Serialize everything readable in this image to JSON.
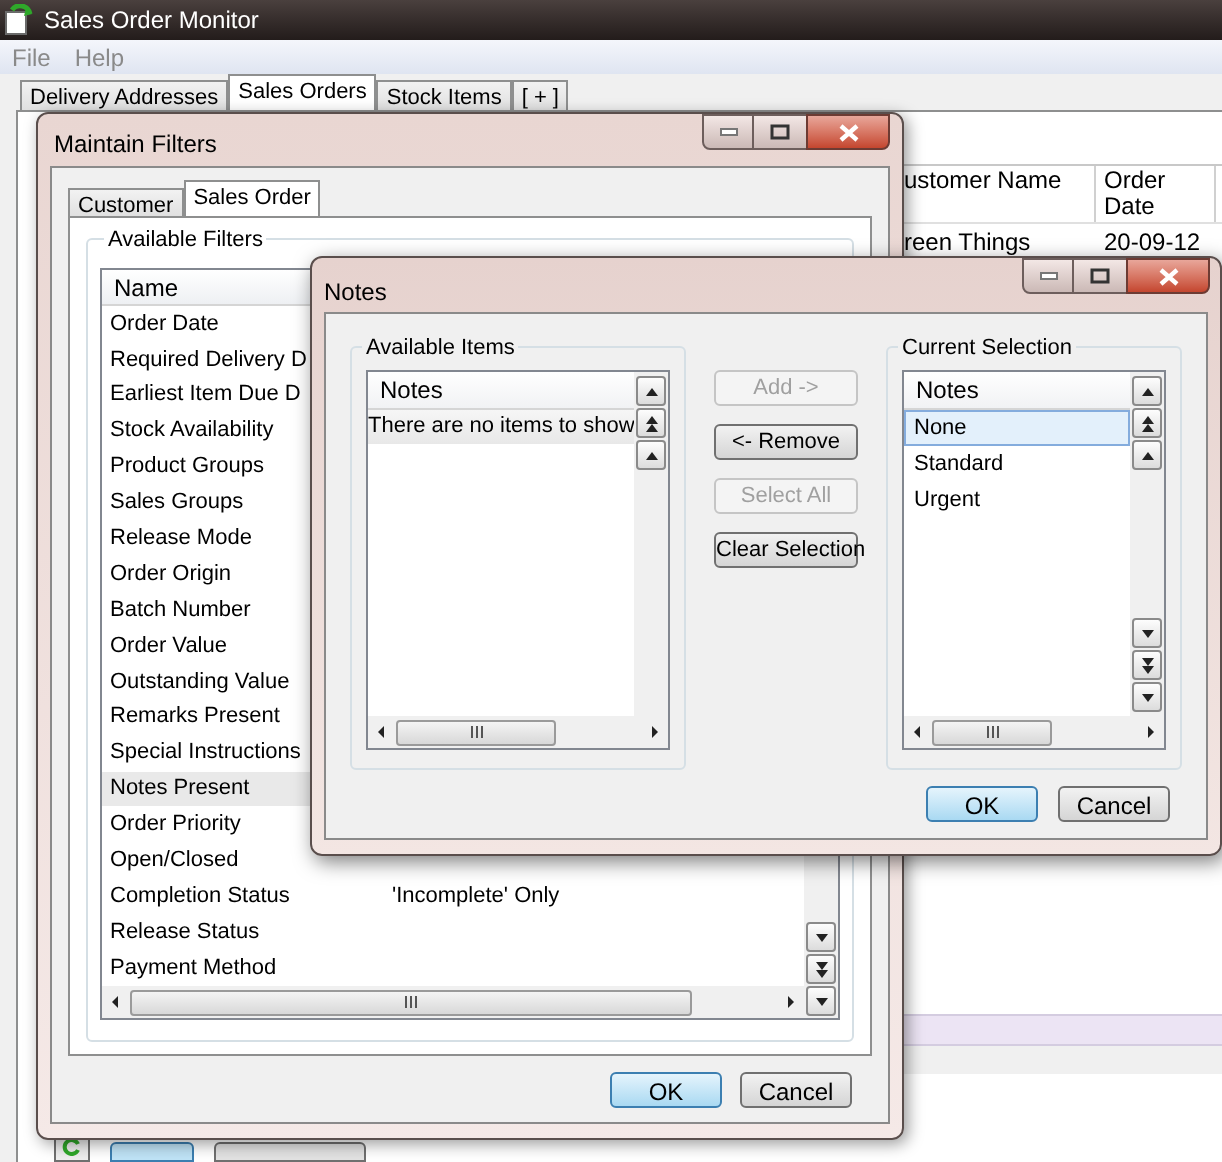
{
  "window": {
    "title": "Sales Order Monitor"
  },
  "menu": [
    "File",
    "Help"
  ],
  "tabs": [
    {
      "label": "Delivery Addresses",
      "selected": false
    },
    {
      "label": "Sales Orders",
      "selected": true
    },
    {
      "label": "Stock Items",
      "selected": false
    },
    {
      "label": "[ + ]",
      "selected": false
    }
  ],
  "grid": {
    "columns": [
      "ustomer Name",
      "Order Date"
    ],
    "rows": [
      [
        "reen Things",
        "20-09-12"
      ]
    ]
  },
  "maintain_filters": {
    "title": "Maintain Filters",
    "tabs": [
      {
        "label": "Customer",
        "selected": false
      },
      {
        "label": "Sales Order",
        "selected": true
      }
    ],
    "group": "Available Filters",
    "column": "Name",
    "rows": [
      {
        "name": "Order Date",
        "setting": "",
        "selected": false
      },
      {
        "name": "Required Delivery D",
        "setting": "",
        "selected": false
      },
      {
        "name": "Earliest Item Due D",
        "setting": "",
        "selected": false
      },
      {
        "name": "Stock Availability",
        "setting": "",
        "selected": false
      },
      {
        "name": "Product Groups",
        "setting": "",
        "selected": false
      },
      {
        "name": "Sales Groups",
        "setting": "",
        "selected": false
      },
      {
        "name": "Release Mode",
        "setting": "",
        "selected": false
      },
      {
        "name": "Order Origin",
        "setting": "",
        "selected": false
      },
      {
        "name": "Batch Number",
        "setting": "",
        "selected": false
      },
      {
        "name": "Order Value",
        "setting": "",
        "selected": false
      },
      {
        "name": "Outstanding Value",
        "setting": "",
        "selected": false
      },
      {
        "name": "Remarks Present",
        "setting": "",
        "selected": false
      },
      {
        "name": "Special Instructions",
        "setting": "",
        "selected": false
      },
      {
        "name": "Notes Present",
        "setting": "",
        "selected": true
      },
      {
        "name": "Order Priority",
        "setting": "",
        "selected": false
      },
      {
        "name": "Open/Closed",
        "setting": "",
        "selected": false
      },
      {
        "name": "Completion Status",
        "setting": "'Incomplete' Only",
        "selected": false
      },
      {
        "name": "Release Status",
        "setting": "",
        "selected": false
      },
      {
        "name": "Payment Method",
        "setting": "",
        "selected": false
      }
    ],
    "buttons": [
      {
        "label": "OK",
        "default": true
      },
      {
        "label": "Cancel",
        "default": false
      }
    ]
  },
  "notes_dialog": {
    "title": "Notes",
    "available": {
      "label": "Available Items",
      "column": "Notes",
      "empty_text": "There are no items to show"
    },
    "actions": [
      {
        "label": "Add ->",
        "disabled": true
      },
      {
        "label": "<- Remove",
        "disabled": false
      },
      {
        "label": "Select All",
        "disabled": true
      },
      {
        "label": "Clear Selection",
        "disabled": false
      }
    ],
    "current": {
      "label": "Current Selection",
      "column": "Notes",
      "items": [
        {
          "label": "None",
          "selected": true
        },
        {
          "label": "Standard",
          "selected": false
        },
        {
          "label": "Urgent",
          "selected": false
        }
      ]
    },
    "buttons": [
      {
        "label": "OK",
        "default": true
      },
      {
        "label": "Cancel",
        "default": false
      }
    ]
  }
}
